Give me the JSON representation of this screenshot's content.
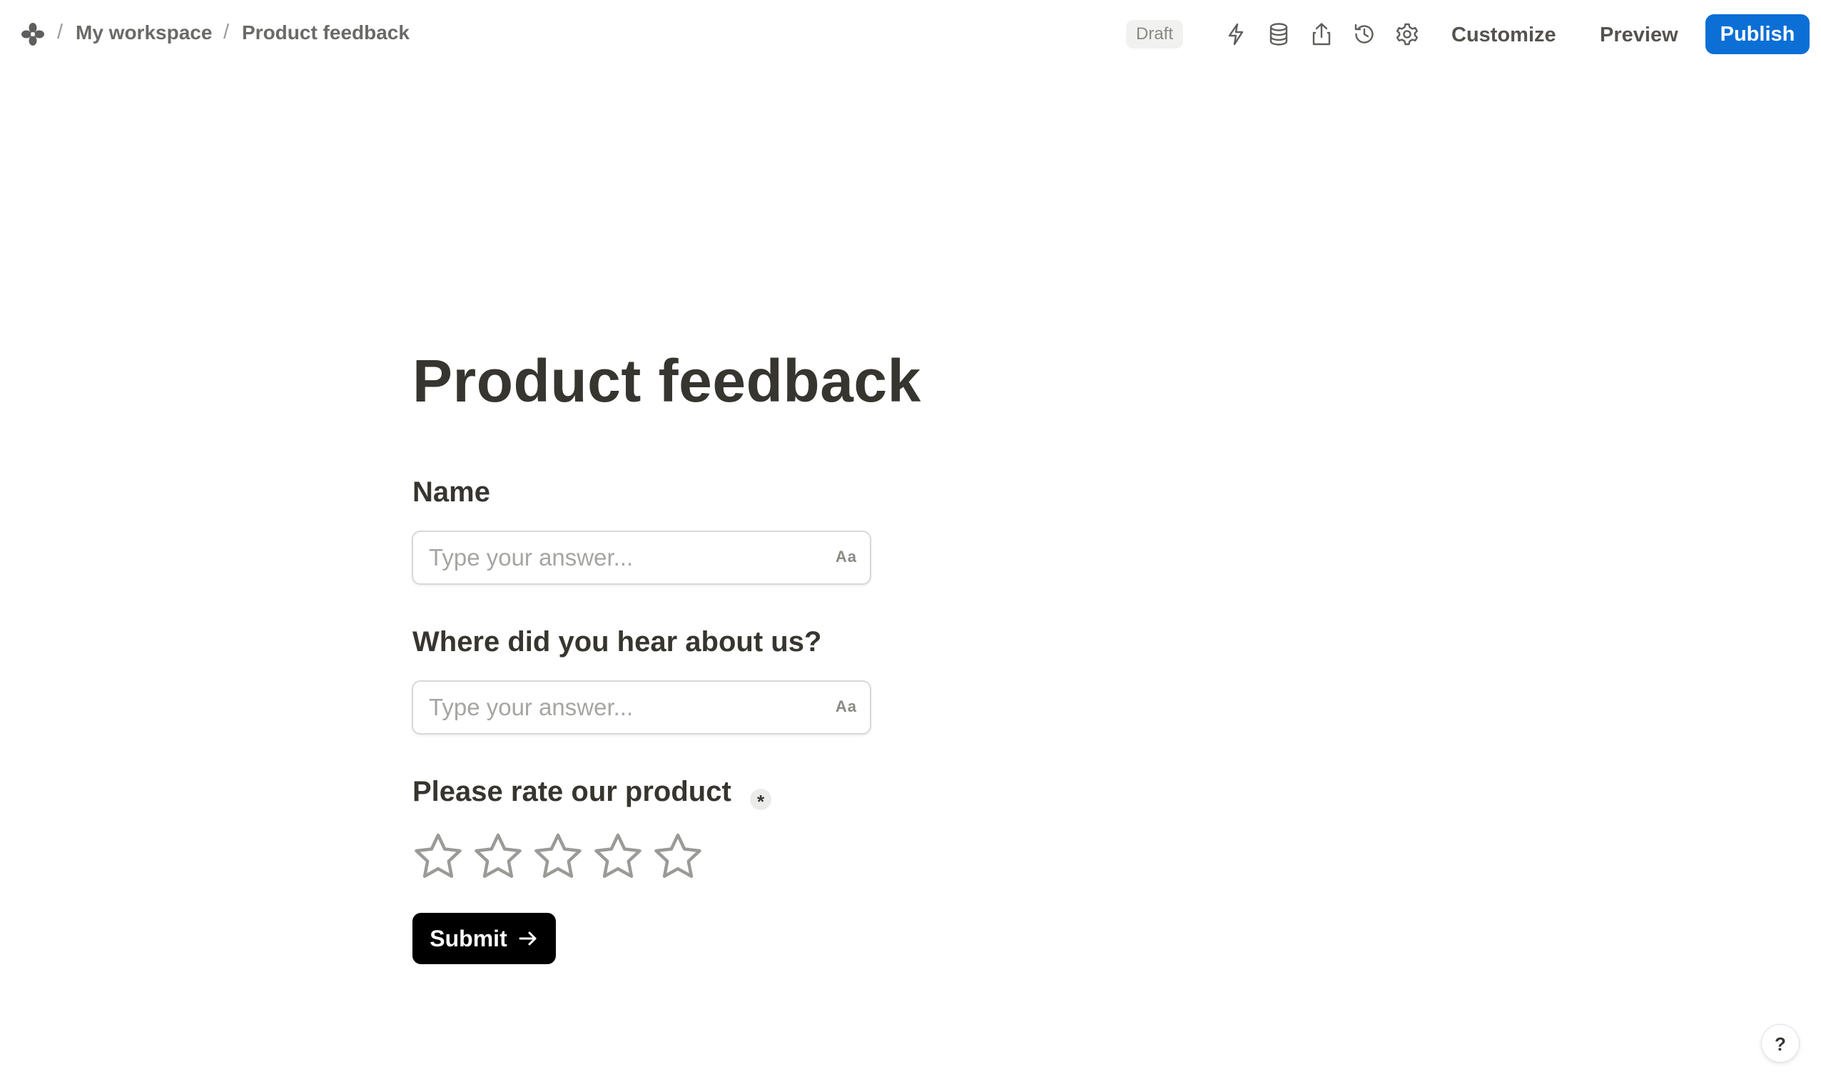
{
  "breadcrumb": {
    "workspace": "My workspace",
    "page": "Product feedback",
    "separator": "/"
  },
  "header": {
    "status_badge": "Draft",
    "icons": [
      "automation-bolt-icon",
      "database-icon",
      "share-upload-icon",
      "history-icon",
      "settings-gear-icon"
    ],
    "customize_label": "Customize",
    "preview_label": "Preview",
    "publish_label": "Publish"
  },
  "form": {
    "title": "Product feedback",
    "questions": [
      {
        "label": "Name",
        "placeholder": "Type your answer...",
        "type_hint": "Aa"
      },
      {
        "label": "Where did you hear about us?",
        "placeholder": "Type your answer...",
        "type_hint": "Aa"
      },
      {
        "label": "Please rate our product",
        "required_mark": "*",
        "rating_max": 5,
        "rating_value": 0
      }
    ],
    "submit_label": "Submit"
  },
  "help": {
    "label": "?"
  },
  "colors": {
    "publish_blue": "#0b6fd6",
    "submit_black": "#000000",
    "text": "#37352f",
    "star_outline": "#9b9a97"
  }
}
